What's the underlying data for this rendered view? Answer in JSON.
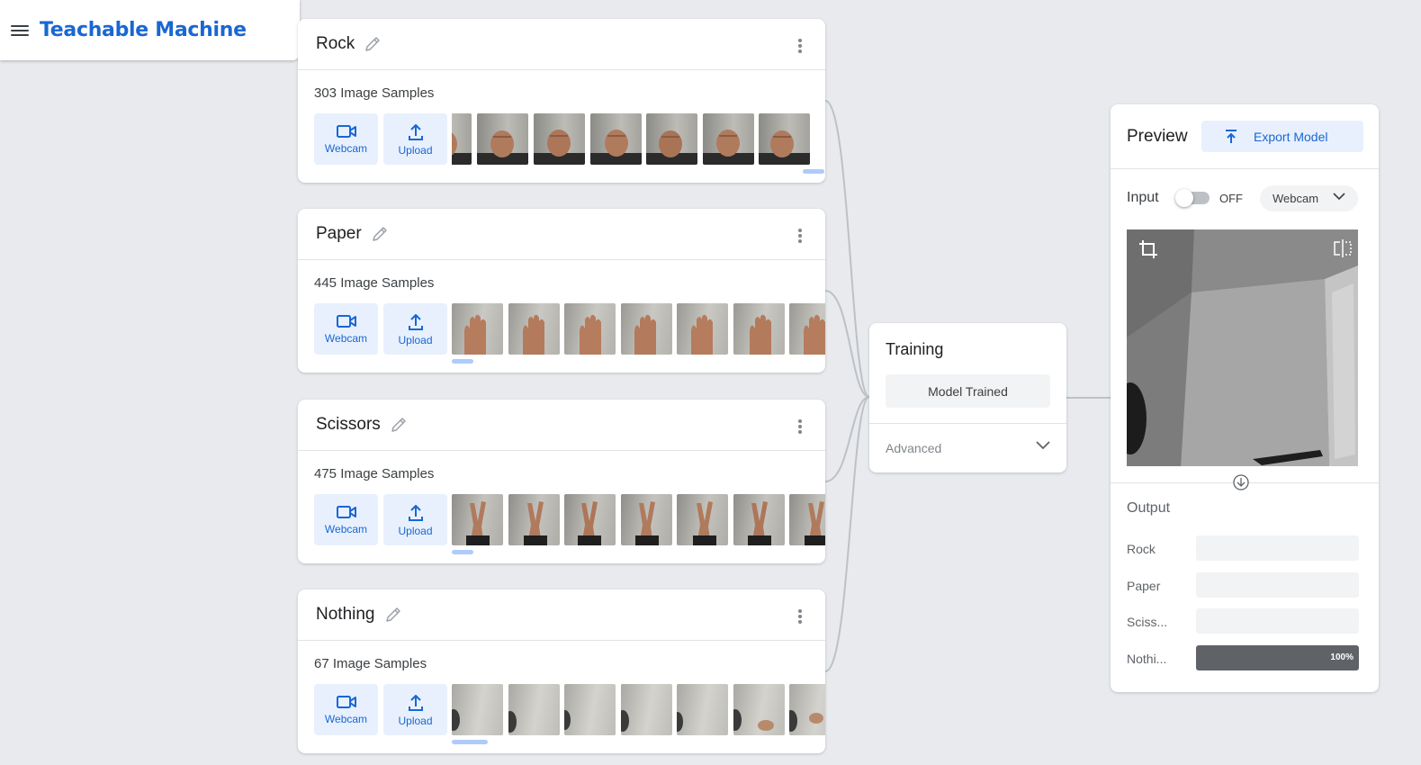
{
  "app": {
    "title": "Teachable Machine"
  },
  "classes": [
    {
      "name": "Rock",
      "samples": "303 Image Samples",
      "webcam_label": "Webcam",
      "upload_label": "Upload"
    },
    {
      "name": "Paper",
      "samples": "445 Image Samples",
      "webcam_label": "Webcam",
      "upload_label": "Upload"
    },
    {
      "name": "Scissors",
      "samples": "475 Image Samples",
      "webcam_label": "Webcam",
      "upload_label": "Upload"
    },
    {
      "name": "Nothing",
      "samples": "67 Image Samples",
      "webcam_label": "Webcam",
      "upload_label": "Upload"
    }
  ],
  "training": {
    "title": "Training",
    "button_label": "Model Trained",
    "advanced_label": "Advanced"
  },
  "preview": {
    "title": "Preview",
    "export_label": "Export Model",
    "input_label": "Input",
    "input_toggle_state": "OFF",
    "input_source": "Webcam",
    "output_label": "Output",
    "outputs": [
      {
        "label": "Rock",
        "confidence": 0
      },
      {
        "label": "Paper",
        "confidence": 0
      },
      {
        "label": "Sciss...",
        "confidence": 0
      },
      {
        "label": "Nothi...",
        "confidence": 1.0,
        "text": "100%"
      }
    ]
  },
  "colors": {
    "accent": "#1967d2",
    "accent_light": "#e8f0fe",
    "background": "#e8eaed",
    "output_fill": "#5f6368"
  },
  "icons": {
    "menu": "menu-icon",
    "edit": "pencil-icon",
    "more": "more-vert-icon",
    "webcam": "videocam-icon",
    "upload": "upload-icon",
    "export": "export-upload-icon",
    "crop": "crop-icon",
    "flip": "flip-icon",
    "chevron": "chevron-down-icon",
    "arrow_down": "arrow-down-circle-icon"
  }
}
